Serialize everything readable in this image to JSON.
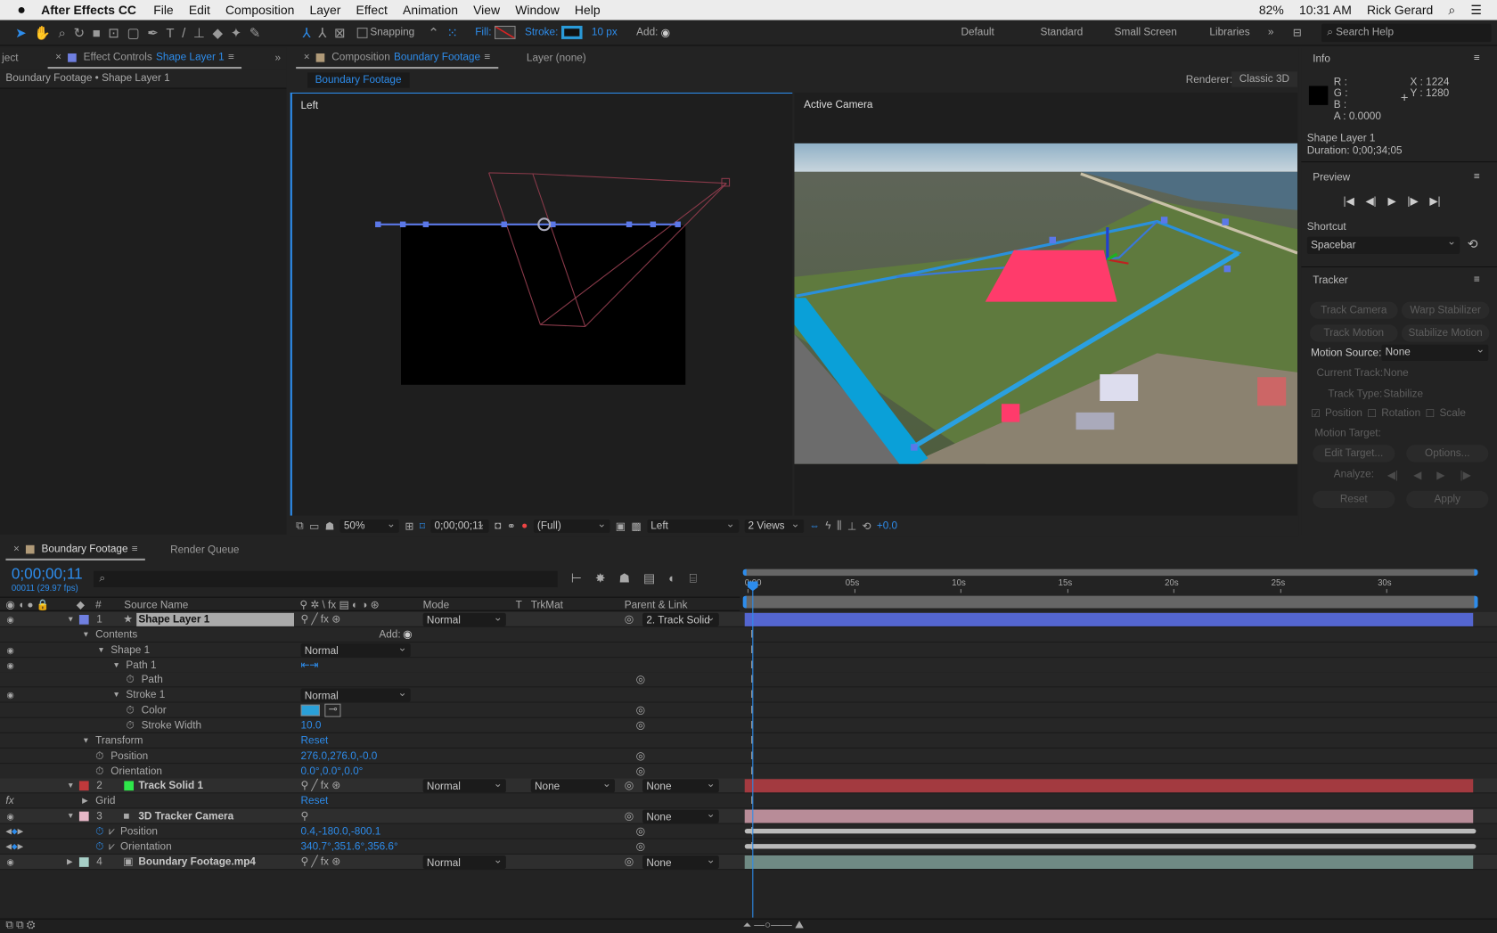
{
  "menubar": {
    "app": "After Effects CC",
    "items": [
      "File",
      "Edit",
      "Composition",
      "Layer",
      "Effect",
      "Animation",
      "View",
      "Window",
      "Help"
    ],
    "battery": "82%",
    "time": "10:31 AM",
    "user": "Rick Gerard"
  },
  "toolbar": {
    "snapping": "Snapping",
    "fill": "Fill:",
    "stroke": "Stroke:",
    "stroke_width": "10 px",
    "add": "Add:",
    "workspaces": [
      "Default",
      "Standard",
      "Small Screen",
      "Libraries"
    ],
    "search_placeholder": "Search Help"
  },
  "left_panel": {
    "tab_project": "ject",
    "tab_prefix": "Effect Controls",
    "tab_layer": "Shape Layer 1",
    "breadcrumb": "Boundary Footage • Shape Layer 1"
  },
  "comp_panel": {
    "tab_prefix": "Composition",
    "tab_comp": "Boundary Footage",
    "tab_layer": "Layer (none)",
    "subtab": "Boundary Footage",
    "renderer_label": "Renderer:",
    "renderer": "Classic 3D",
    "view_left": "Left",
    "view_right": "Active Camera",
    "bottom": {
      "zoom": "50%",
      "timecode": "0;00;00;11",
      "resolution": "(Full)",
      "view": "Left",
      "views": "2 Views",
      "exposure": "+0.0"
    }
  },
  "info": {
    "title": "Info",
    "r": "R :",
    "g": "G :",
    "b": "B :",
    "a": "A :  0.0000",
    "x": "X : 1224",
    "y": "Y :  1280",
    "layer": "Shape Layer 1",
    "duration": "Duration: 0;00;34;05"
  },
  "preview": {
    "title": "Preview",
    "shortcut_label": "Shortcut",
    "shortcut": "Spacebar"
  },
  "tracker": {
    "title": "Tracker",
    "track_camera": "Track Camera",
    "warp": "Warp Stabilizer",
    "track_motion": "Track Motion",
    "stabilize": "Stabilize Motion",
    "motion_source_label": "Motion Source:",
    "motion_source": "None",
    "current_track_label": "Current Track:",
    "current_track": "None",
    "track_type_label": "Track Type:",
    "track_type": "Stabilize",
    "position": "Position",
    "rotation": "Rotation",
    "scale": "Scale",
    "motion_target": "Motion Target:",
    "edit_target": "Edit Target...",
    "options": "Options...",
    "analyze": "Analyze:",
    "reset": "Reset",
    "apply": "Apply"
  },
  "timeline": {
    "tab": "Boundary Footage",
    "render_queue": "Render Queue",
    "timecode": "0;00;00;11",
    "frames": "00011 (29.97 fps)",
    "headers": {
      "num": "#",
      "source": "Source Name",
      "mode": "Mode",
      "t": "T",
      "trkmat": "TrkMat",
      "parent": "Parent & Link"
    },
    "ruler": [
      "0:00",
      "05s",
      "10s",
      "15s",
      "20s",
      "25s",
      "30s"
    ],
    "rows": [
      {
        "type": "layer",
        "num": "1",
        "name": "Shape Layer 1",
        "label": "#6f7fe0",
        "mode": "Normal",
        "parent": "2. Track Solid",
        "bar": "#5466d0",
        "selected": true,
        "eye": true
      },
      {
        "type": "prop",
        "indent": 1,
        "name": "Contents",
        "value": "",
        "add": "Add:"
      },
      {
        "type": "prop",
        "indent": 2,
        "name": "Shape 1",
        "dd": "Normal",
        "eye": true
      },
      {
        "type": "prop",
        "indent": 3,
        "name": "Path 1",
        "eye": true
      },
      {
        "type": "prop",
        "indent": 4,
        "name": "Path",
        "stopwatch": true
      },
      {
        "type": "prop",
        "indent": 3,
        "name": "Stroke 1",
        "dd": "Normal",
        "eye": true
      },
      {
        "type": "prop",
        "indent": 4,
        "name": "Color",
        "stopwatch": true,
        "swatch": "#2aa0d8"
      },
      {
        "type": "prop",
        "indent": 4,
        "name": "Stroke Width",
        "stopwatch": true,
        "value": "10.0"
      },
      {
        "type": "prop",
        "indent": 1,
        "name": "Transform",
        "value": "Reset"
      },
      {
        "type": "prop",
        "indent": 2,
        "name": "Position",
        "stopwatch": true,
        "value": "276.0,276.0,-0.0"
      },
      {
        "type": "prop",
        "indent": 2,
        "name": "Orientation",
        "stopwatch": true,
        "value": "0.0°,0.0°,0.0°"
      },
      {
        "type": "layer",
        "num": "2",
        "name": "Track Solid 1",
        "label": "#c0393b",
        "mode": "Normal",
        "trkmat": "None",
        "parent": "None",
        "bar": "#a33a40",
        "icon": "#2ee84a"
      },
      {
        "type": "prop",
        "indent": 1,
        "name": "Grid",
        "value": "Reset",
        "fx": true
      },
      {
        "type": "layer",
        "num": "3",
        "name": "3D Tracker Camera",
        "label": "#e8b8c8",
        "parent": "None",
        "bar": "#b88c98",
        "eye": true
      },
      {
        "type": "prop",
        "indent": 2,
        "name": "Position",
        "stopwatch": true,
        "value": "0.4,-180.0,-800.1",
        "kf": true
      },
      {
        "type": "prop",
        "indent": 2,
        "name": "Orientation",
        "stopwatch": true,
        "value": "340.7°,351.6°,356.6°",
        "kf": true
      },
      {
        "type": "layer",
        "num": "4",
        "name": "Boundary Footage.mp4",
        "label": "#a8d0c8",
        "mode": "Normal",
        "parent": "None",
        "bar": "#6f8a84",
        "eye": true
      }
    ]
  },
  "colors": {
    "accent": "#2d8ceb",
    "panel": "#232323",
    "shape_fill": "#ff3b6b",
    "stroke_color": "#2aa0d8"
  }
}
